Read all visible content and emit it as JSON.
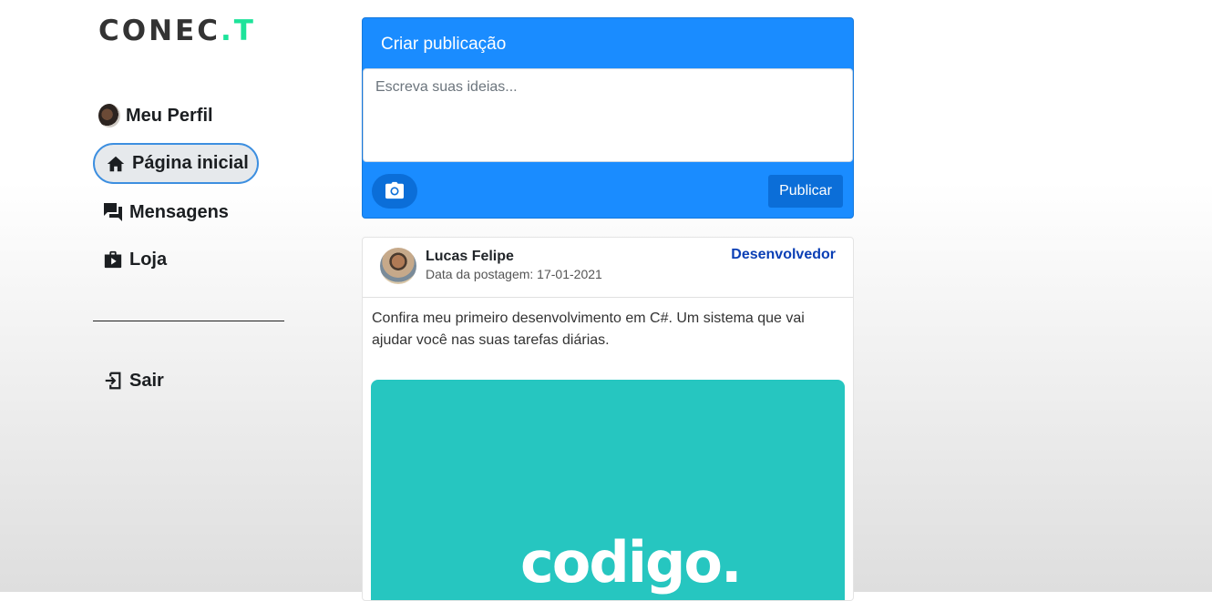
{
  "app": {
    "logo_main": "CONEC",
    "logo_accent": ".T",
    "accent_color": "#1de39a",
    "primary_color": "#1a8cff"
  },
  "sidebar": {
    "items": [
      {
        "label": "Meu Perfil",
        "icon": "avatar-icon"
      },
      {
        "label": "Página inicial",
        "icon": "home-icon",
        "active": true
      },
      {
        "label": "Mensagens",
        "icon": "chat-icon"
      },
      {
        "label": "Loja",
        "icon": "shopping-bag-icon"
      }
    ],
    "logout": {
      "label": "Sair",
      "icon": "logout-icon"
    }
  },
  "create_post": {
    "title": "Criar publicação",
    "placeholder": "Escreva suas ideias...",
    "camera_icon": "camera-icon",
    "publish_label": "Publicar"
  },
  "post": {
    "author": "Lucas Felipe",
    "date": "Data da postagem: 17-01-2021",
    "role": "Desenvolvedor",
    "text": "Confira meu primeiro desenvolvimento em C#. Um sistema que vai ajudar você nas suas tarefas diárias.",
    "image_text": "codigo."
  }
}
